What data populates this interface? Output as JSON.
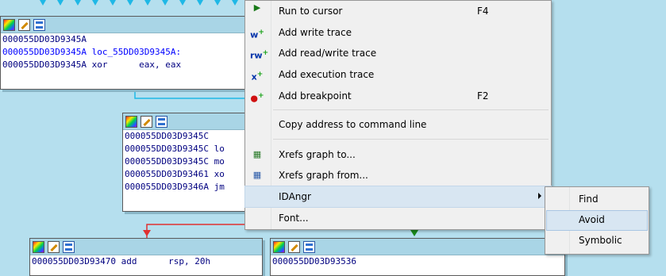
{
  "graph": {
    "node1": {
      "lines": [
        "000055DD03D9345A",
        "000055DD03D9345A loc_55DD03D9345A:",
        "000055DD03D9345A xor      eax, eax"
      ]
    },
    "node2": {
      "lines": [
        "000055DD03D9345C",
        "000055DD03D9345C lo",
        "000055DD03D9345C mo",
        "000055DD03D93461 xo",
        "000055DD03D9346A jm"
      ]
    },
    "node3": {
      "lines": [
        "000055DD03D93470 add      rsp, 20h"
      ]
    },
    "node4": {
      "lines": [
        "000055DD03D93536"
      ]
    }
  },
  "context_menu": {
    "items": [
      {
        "label": "Run to cursor",
        "shortcut": "F4",
        "icon": "run-to-cursor-icon"
      },
      {
        "label": "Add write trace",
        "icon": "write-trace-icon"
      },
      {
        "label": "Add read/write trace",
        "icon": "read-write-trace-icon"
      },
      {
        "label": "Add execution trace",
        "icon": "execution-trace-icon"
      },
      {
        "label": "Add breakpoint",
        "shortcut": "F2",
        "icon": "breakpoint-icon"
      },
      {
        "label": "Copy address to command line"
      },
      {
        "label": "Xrefs graph to...",
        "icon": "xrefs-graph-to-icon"
      },
      {
        "label": "Xrefs graph from...",
        "icon": "xrefs-graph-from-icon"
      },
      {
        "label": "IDAngr",
        "has_submenu": true
      },
      {
        "label": "Font..."
      }
    ]
  },
  "submenu": {
    "items": [
      {
        "label": "Find"
      },
      {
        "label": "Avoid"
      },
      {
        "label": "Symbolic"
      }
    ]
  },
  "colors": {
    "background": "#b5dfee",
    "node_header": "#a9d5e6",
    "edge_red": "#e03030",
    "edge_green": "#1a8a1a",
    "edge_cyan": "#1fb8e6",
    "menu_highlight": "#d8e6f2"
  }
}
